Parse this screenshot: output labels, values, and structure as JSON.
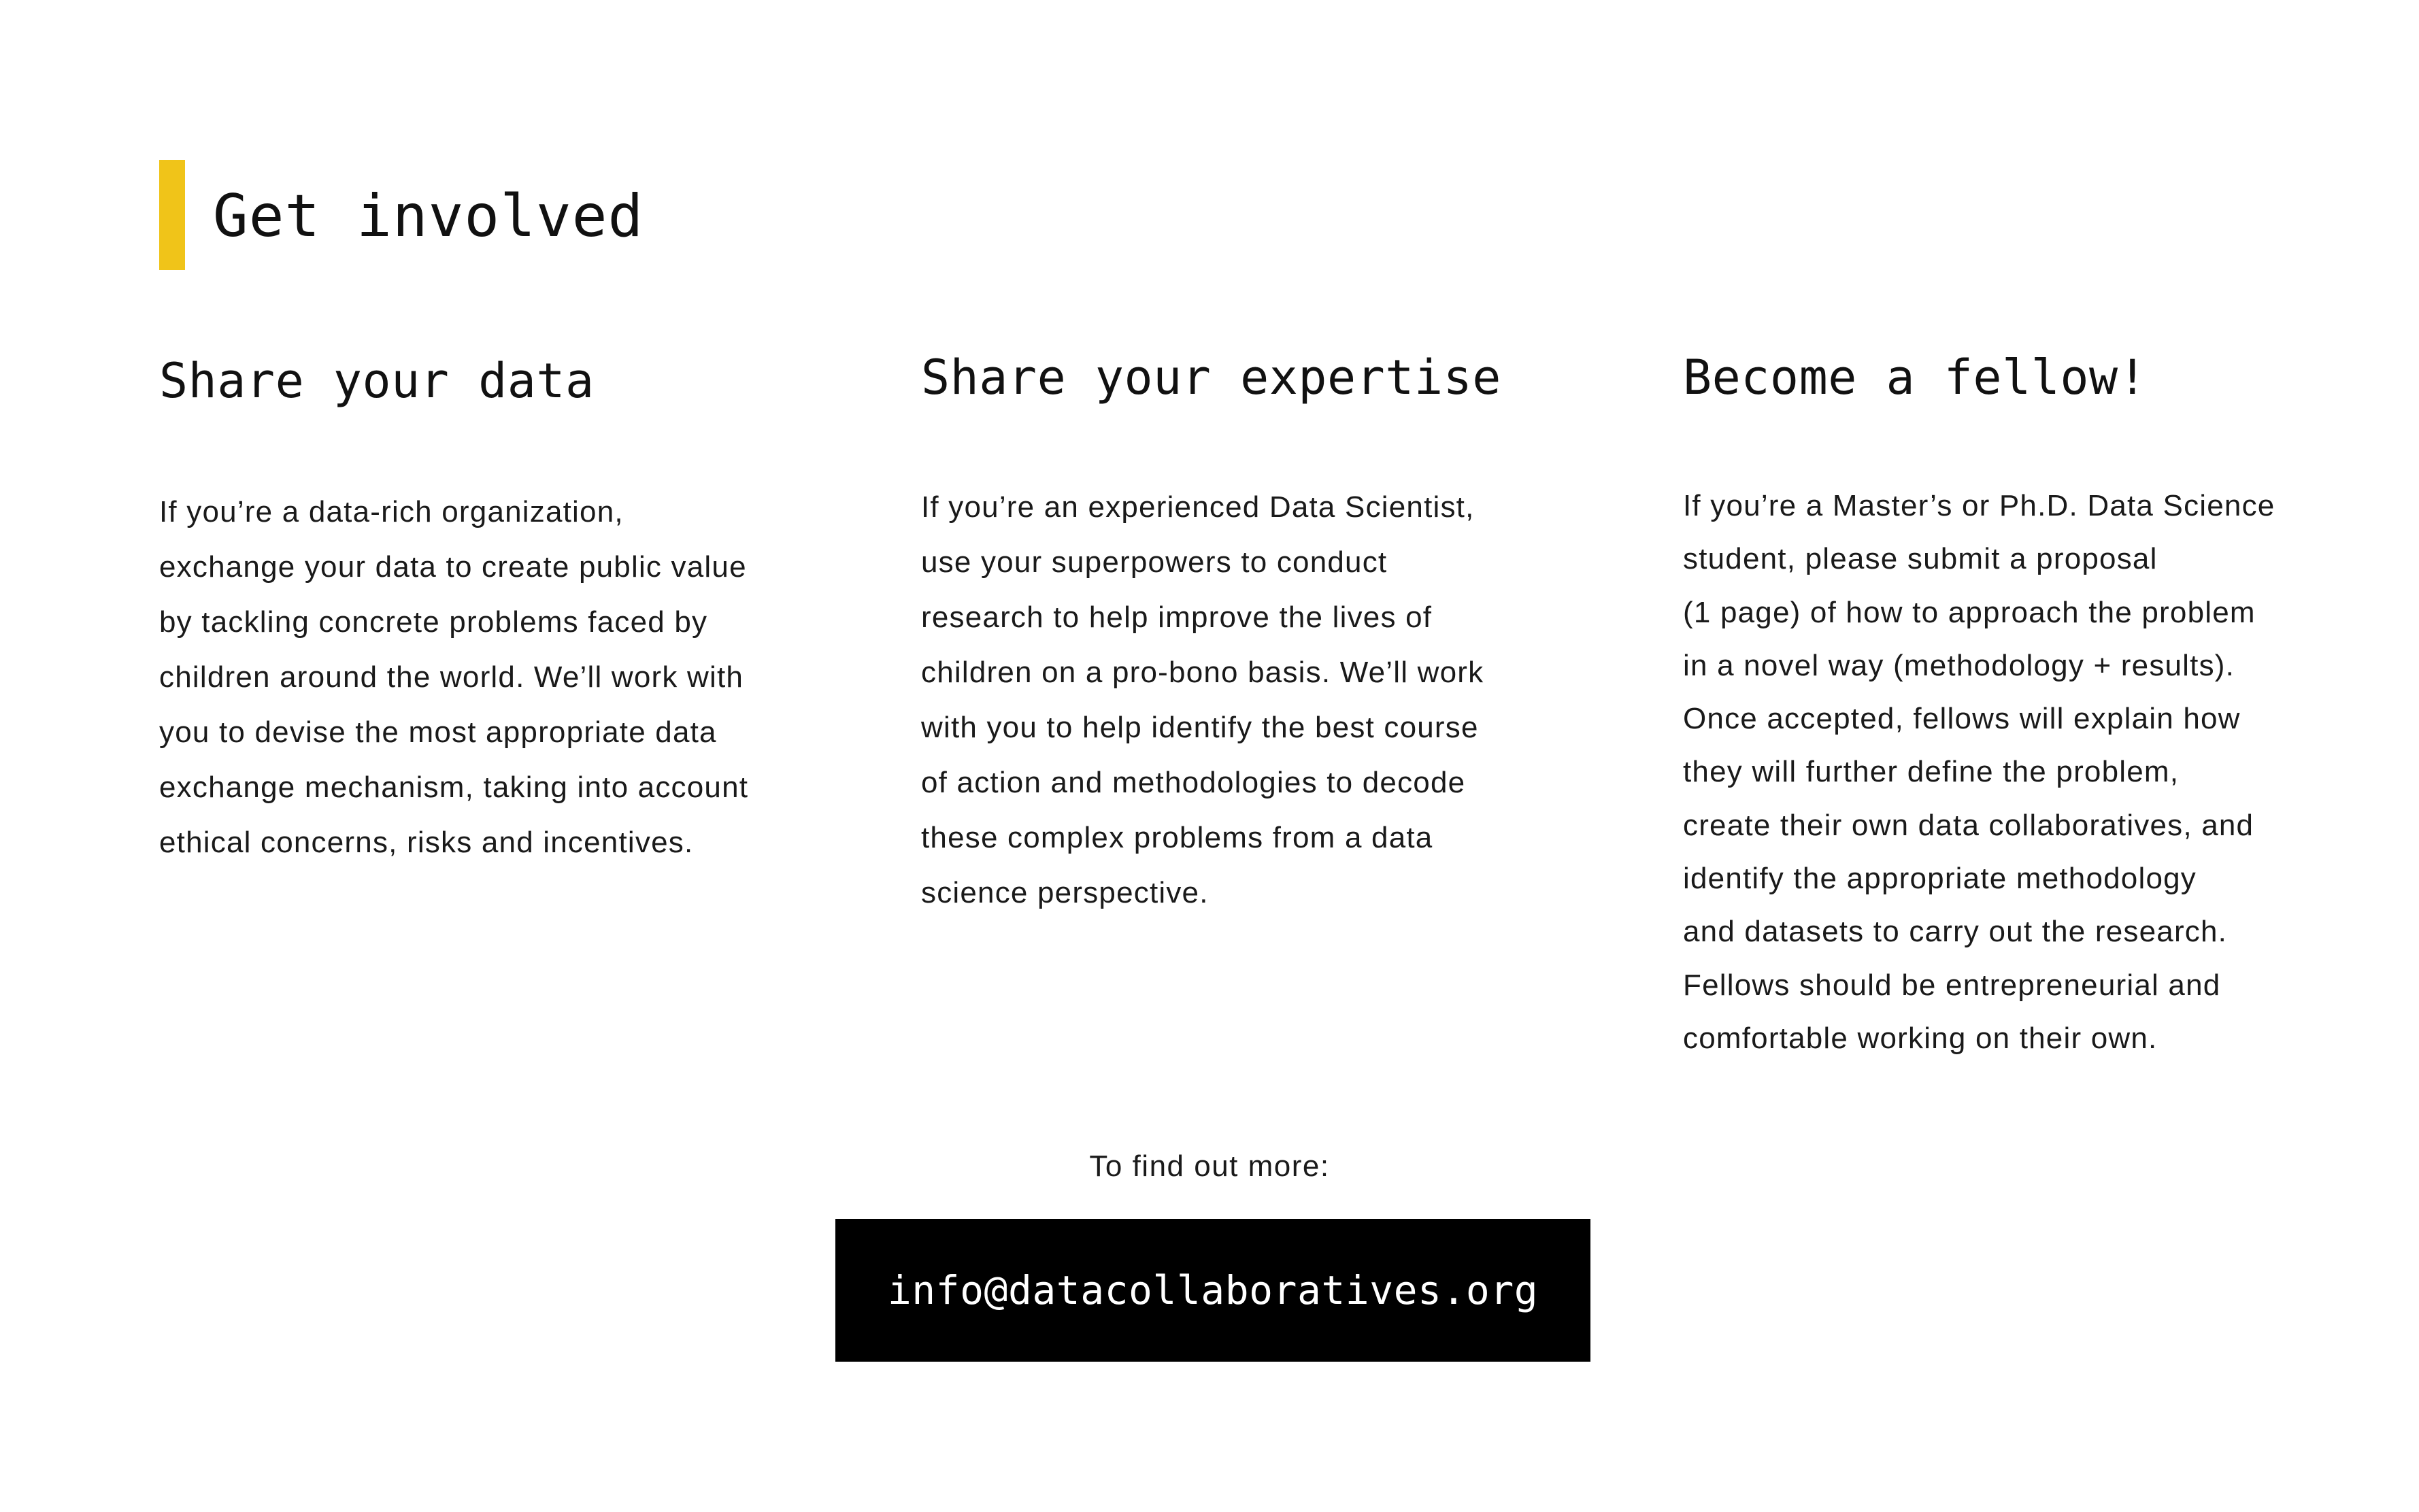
{
  "colors": {
    "accent": "#f0c419",
    "text": "#111111",
    "button_background": "#000000",
    "button_text": "#ffffff"
  },
  "header": {
    "title": "Get involved"
  },
  "columns": [
    {
      "heading": "Share your data",
      "lines": [
        "If you’re a data-rich organization,",
        "exchange your data to create public value",
        "by tackling concrete problems faced by",
        "children around the world. We’ll work with",
        "you to devise the most appropriate data",
        "exchange mechanism, taking into account",
        "ethical concerns, risks and incentives."
      ]
    },
    {
      "heading": "Share your expertise",
      "lines": [
        "If you’re an experienced Data Scientist,",
        "use your superpowers to conduct",
        "research to help improve the lives of",
        "children on a pro-bono basis. We’ll work",
        "with you to help identify the best course",
        "of action and methodologies to decode",
        "these complex problems from a data",
        "science perspective."
      ]
    },
    {
      "heading": "Become a fellow!",
      "lines": [
        "If you’re a Master’s or Ph.D. Data Science",
        "student, please submit a proposal",
        "(1 page) of how to approach the problem",
        "in a novel way (methodology + results).",
        "Once accepted, fellows will explain how",
        "they will further define the problem,",
        "create their own data collaboratives, and",
        "identify the appropriate methodology",
        "and datasets to carry out the research.",
        "Fellows should be entrepreneurial and",
        "comfortable working on their own."
      ]
    }
  ],
  "contact": {
    "prompt": "To find out more:",
    "email": "info@datacollaboratives.org"
  }
}
